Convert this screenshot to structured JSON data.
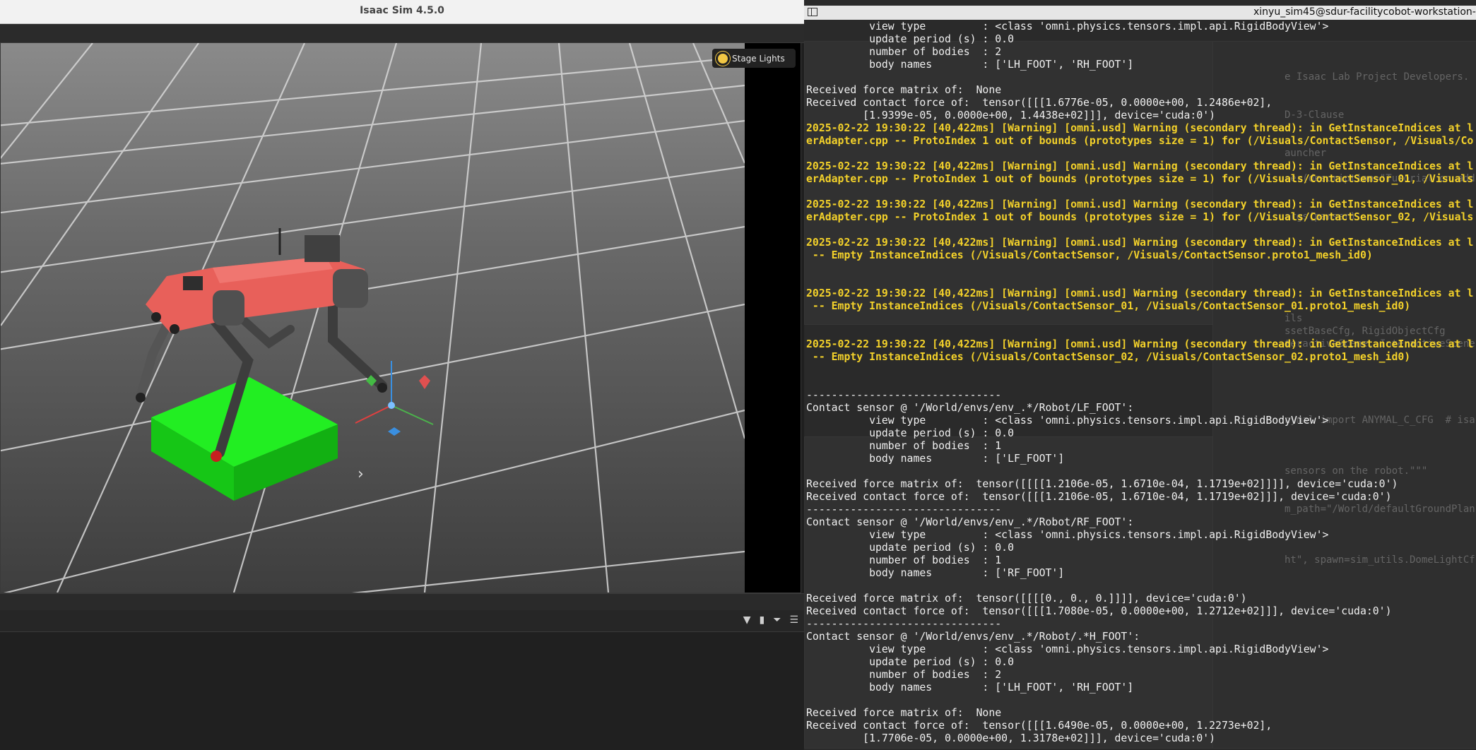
{
  "isaac": {
    "title": "Isaac Sim 4.5.0",
    "viewport": {
      "stage_lights_label": "Stage Lights"
    }
  },
  "terminal": {
    "title": "xinyu_sim45@sdur-facilitycobot-workstation-2:",
    "lines": [
      {
        "text": "          view type         : <class 'omni.physics.tensors.impl.api.RigidBodyView'>",
        "warn": false
      },
      {
        "text": "          update period (s) : 0.0",
        "warn": false
      },
      {
        "text": "          number of bodies  : 2",
        "warn": false
      },
      {
        "text": "          body names        : ['LH_FOOT', 'RH_FOOT']",
        "warn": false
      },
      {
        "text": "",
        "warn": false
      },
      {
        "text": "Received force matrix of:  None",
        "warn": false
      },
      {
        "text": "Received contact force of:  tensor([[[1.6776e-05, 0.0000e+00, 1.2486e+02],",
        "warn": false
      },
      {
        "text": "         [1.9399e-05, 0.0000e+00, 1.4438e+02]]], device='cuda:0')",
        "warn": false
      },
      {
        "text": "2025-02-22 19:30:22 [40,422ms] [Warning] [omni.usd] Warning (secondary thread): in GetInstanceIndices at l",
        "warn": true
      },
      {
        "text": "erAdapter.cpp -- ProtoIndex 1 out of bounds (prototypes size = 1) for (/Visuals/ContactSensor, /Visuals/Co",
        "warn": true
      },
      {
        "text": "",
        "warn": false
      },
      {
        "text": "2025-02-22 19:30:22 [40,422ms] [Warning] [omni.usd] Warning (secondary thread): in GetInstanceIndices at l",
        "warn": true
      },
      {
        "text": "erAdapter.cpp -- ProtoIndex 1 out of bounds (prototypes size = 1) for (/Visuals/ContactSensor_01, /Visuals",
        "warn": true
      },
      {
        "text": "",
        "warn": false
      },
      {
        "text": "2025-02-22 19:30:22 [40,422ms] [Warning] [omni.usd] Warning (secondary thread): in GetInstanceIndices at l",
        "warn": true
      },
      {
        "text": "erAdapter.cpp -- ProtoIndex 1 out of bounds (prototypes size = 1) for (/Visuals/ContactSensor_02, /Visuals",
        "warn": true
      },
      {
        "text": "",
        "warn": false
      },
      {
        "text": "2025-02-22 19:30:22 [40,422ms] [Warning] [omni.usd] Warning (secondary thread): in GetInstanceIndices at l",
        "warn": true
      },
      {
        "text": " -- Empty InstanceIndices (/Visuals/ContactSensor, /Visuals/ContactSensor.proto1_mesh_id0)",
        "warn": true
      },
      {
        "text": "",
        "warn": false
      },
      {
        "text": "",
        "warn": false
      },
      {
        "text": "2025-02-22 19:30:22 [40,422ms] [Warning] [omni.usd] Warning (secondary thread): in GetInstanceIndices at l",
        "warn": true
      },
      {
        "text": " -- Empty InstanceIndices (/Visuals/ContactSensor_01, /Visuals/ContactSensor_01.proto1_mesh_id0)",
        "warn": true
      },
      {
        "text": "",
        "warn": false
      },
      {
        "text": "",
        "warn": false
      },
      {
        "text": "2025-02-22 19:30:22 [40,422ms] [Warning] [omni.usd] Warning (secondary thread): in GetInstanceIndices at l",
        "warn": true
      },
      {
        "text": " -- Empty InstanceIndices (/Visuals/ContactSensor_02, /Visuals/ContactSensor_02.proto1_mesh_id0)",
        "warn": true
      },
      {
        "text": "",
        "warn": false
      },
      {
        "text": "",
        "warn": false
      },
      {
        "text": "-------------------------------",
        "warn": false
      },
      {
        "text": "Contact sensor @ '/World/envs/env_.*/Robot/LF_FOOT':",
        "warn": false
      },
      {
        "text": "          view type         : <class 'omni.physics.tensors.impl.api.RigidBodyView'>",
        "warn": false
      },
      {
        "text": "          update period (s) : 0.0",
        "warn": false
      },
      {
        "text": "          number of bodies  : 1",
        "warn": false
      },
      {
        "text": "          body names        : ['LF_FOOT']",
        "warn": false
      },
      {
        "text": "",
        "warn": false
      },
      {
        "text": "Received force matrix of:  tensor([[[[1.2106e-05, 1.6710e-04, 1.1719e+02]]]], device='cuda:0')",
        "warn": false
      },
      {
        "text": "Received contact force of:  tensor([[[1.2106e-05, 1.6710e-04, 1.1719e+02]]], device='cuda:0')",
        "warn": false
      },
      {
        "text": "-------------------------------",
        "warn": false
      },
      {
        "text": "Contact sensor @ '/World/envs/env_.*/Robot/RF_FOOT':",
        "warn": false
      },
      {
        "text": "          view type         : <class 'omni.physics.tensors.impl.api.RigidBodyView'>",
        "warn": false
      },
      {
        "text": "          update period (s) : 0.0",
        "warn": false
      },
      {
        "text": "          number of bodies  : 1",
        "warn": false
      },
      {
        "text": "          body names        : ['RF_FOOT']",
        "warn": false
      },
      {
        "text": "",
        "warn": false
      },
      {
        "text": "Received force matrix of:  tensor([[[[0., 0., 0.]]]], device='cuda:0')",
        "warn": false
      },
      {
        "text": "Received contact force of:  tensor([[[1.7080e-05, 0.0000e+00, 1.2712e+02]]], device='cuda:0')",
        "warn": false
      },
      {
        "text": "-------------------------------",
        "warn": false
      },
      {
        "text": "Contact sensor @ '/World/envs/env_.*/Robot/.*H_FOOT':",
        "warn": false
      },
      {
        "text": "          view type         : <class 'omni.physics.tensors.impl.api.RigidBodyView'>",
        "warn": false
      },
      {
        "text": "          update period (s) : 0.0",
        "warn": false
      },
      {
        "text": "          number of bodies  : 2",
        "warn": false
      },
      {
        "text": "          body names        : ['LH_FOOT', 'RH_FOOT']",
        "warn": false
      },
      {
        "text": "",
        "warn": false
      },
      {
        "text": "Received force matrix of:  None",
        "warn": false
      },
      {
        "text": "Received contact force of:  tensor([[[1.6490e-05, 0.0000e+00, 1.2273e+02],",
        "warn": false
      },
      {
        "text": "         [1.7706e-05, 0.0000e+00, 1.3178e+02]]], device='cuda:0')",
        "warn": false
      }
    ]
  },
  "ide_background": {
    "lines": [
      "e Isaac Lab Project Developers.",
      "",
      "",
      "D-3-Clause",
      "",
      "",
      "auncher",
      "",
      "ser(description=\"Tutorial on add",
      "",
      "",
      "args(parser)",
      "",
      "",
      "",
      "",
      "",
      "",
      "",
      "ils",
      "ssetBaseCfg, RigidObjectCfg",
      "teractiveScene, InteractiveScene",
      "",
      "",
      "",
      "",
      "",
      "nymal import ANYMAL_C_CFG  # isa",
      "",
      "",
      "",
      "sensors on the robot.\"\"\"",
      "",
      "",
      "m_path=\"/World/defaultGroundPlan",
      "",
      "",
      "",
      "ht\", spawn=sim_utils.DomeLightCf"
    ]
  },
  "colors": {
    "warning": "#f3d12a",
    "terminal_bg": "#2a2a2a",
    "robot_body": "#e8605a",
    "block": "#1fe51f"
  }
}
